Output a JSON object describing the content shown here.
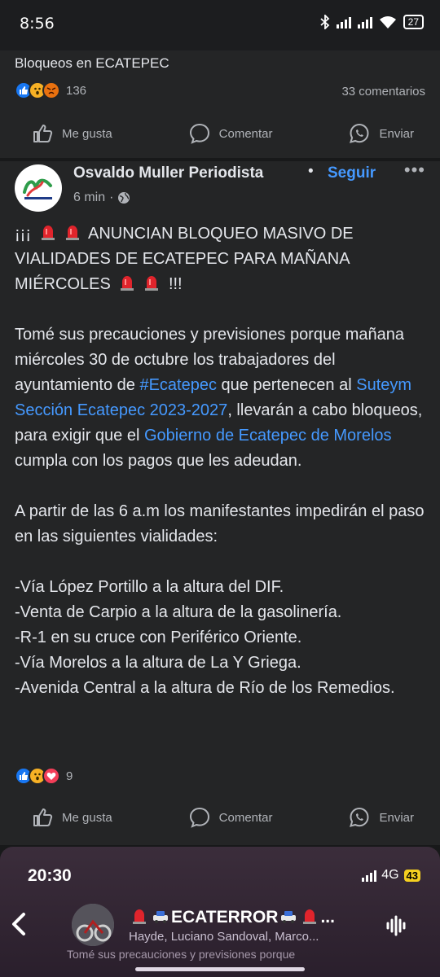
{
  "status_bar": {
    "time": "8:56",
    "battery": "27"
  },
  "previous_post": {
    "title": "Bloqueos en ECATEPEC",
    "reaction_count": "136",
    "comments": "33 comentarios"
  },
  "actions": {
    "like": "Me gusta",
    "comment": "Comentar",
    "share": "Enviar"
  },
  "post": {
    "author": "Osvaldo Muller Periodista",
    "separator": "•",
    "follow": "Seguir",
    "time": "6 min",
    "meta_dot": "·",
    "headline_a": "¡¡¡",
    "headline_b": "ANUNCIAN BLOQUEO MASIVO DE VIALIDADES DE ECATEPEC PARA MAÑANA MIÉRCOLES",
    "headline_c": "!!!",
    "p1_a": "Tomé sus precauciones y previsiones porque mañana miércoles 30 de octubre los trabajadores del ayuntamiento de",
    "p1_link1": "#Ecatepec",
    "p1_b": "que pertenecen al",
    "p1_link2": "Suteym Sección Ecatepec 2023-2027",
    "p1_c": ", llevarán a cabo bloqueos, para exigir que el",
    "p1_link3": "Gobierno de Ecatepec de Morelos",
    "p1_d": "cumpla con los pagos que les adeudan.",
    "p2": "A partir de las 6 a.m los manifestantes impedirán el paso en las siguientes vialidades:",
    "roads": [
      "-Vía López Portillo a la altura del DIF.",
      "-Venta de Carpio a la altura de la gasolinería.",
      "-R-1 en su cruce con Periférico Oriente.",
      "-Vía Morelos a la altura de La Y Griega.",
      "-Avenida Central a la altura de Río de los Remedios."
    ],
    "reaction_count": "9"
  },
  "bottom_sheet": {
    "time": "20:30",
    "network": "4G",
    "battery": "43",
    "chat_title": "ECATERROR",
    "chat_title_suffix": "...",
    "chat_members": "Hayde, Luciano Sandoval, Marco...",
    "peek_text": "Tomé sus precauciones y previsiones porque"
  },
  "colors": {
    "background": "#18191a",
    "card": "#242526",
    "link": "#4599ff",
    "like_blue": "#1877f2"
  },
  "icons": [
    "like-icon",
    "comment-icon",
    "whatsapp-icon",
    "globe-icon",
    "siren-icon",
    "back-arrow-icon",
    "voice-icon",
    "more-icon"
  ]
}
